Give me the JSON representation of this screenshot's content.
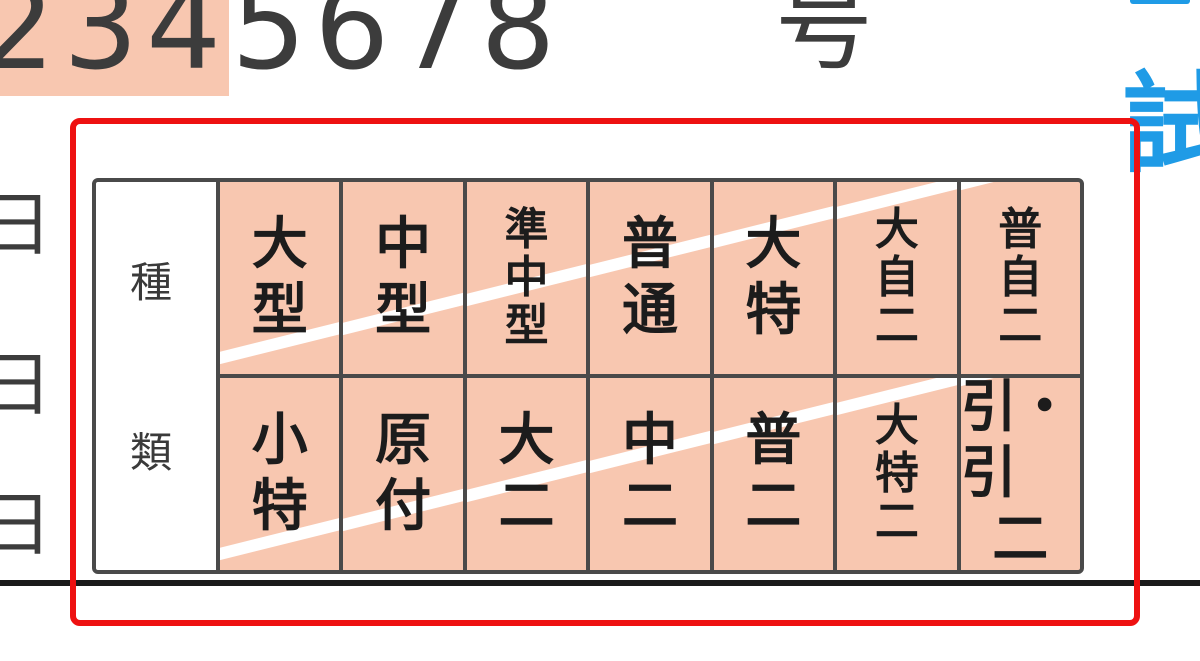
{
  "header": {
    "number_highlighted": "234",
    "number_rest": "5678",
    "number_suffix": "号"
  },
  "side_chars": [
    "日",
    "日",
    "日"
  ],
  "blue_char": "試",
  "license_table": {
    "header_chars": [
      "種",
      "類"
    ],
    "row1": [
      {
        "lines": [
          "大",
          "型"
        ]
      },
      {
        "lines": [
          "中",
          "型"
        ]
      },
      {
        "lines": [
          "準",
          "中",
          "型"
        ]
      },
      {
        "lines": [
          "普",
          "通"
        ]
      },
      {
        "lines": [
          "大",
          "特"
        ]
      },
      {
        "lines": [
          "大",
          "自",
          "二"
        ]
      },
      {
        "lines": [
          "普",
          "自",
          "二"
        ]
      }
    ],
    "row2": [
      {
        "lines": [
          "小",
          "特"
        ]
      },
      {
        "lines": [
          "原",
          "付"
        ]
      },
      {
        "lines": [
          "大",
          "二"
        ]
      },
      {
        "lines": [
          "中",
          "二"
        ]
      },
      {
        "lines": [
          "普",
          "二"
        ]
      },
      {
        "lines": [
          "大",
          "特",
          "二"
        ]
      },
      {
        "lines": [
          "引・引",
          "二"
        ]
      }
    ]
  },
  "colors": {
    "highlight_fill": "#f8c7b0",
    "focus_box": "#ee1111",
    "accent_blue": "#1f9be6",
    "text_dark": "#3c3c3c"
  }
}
